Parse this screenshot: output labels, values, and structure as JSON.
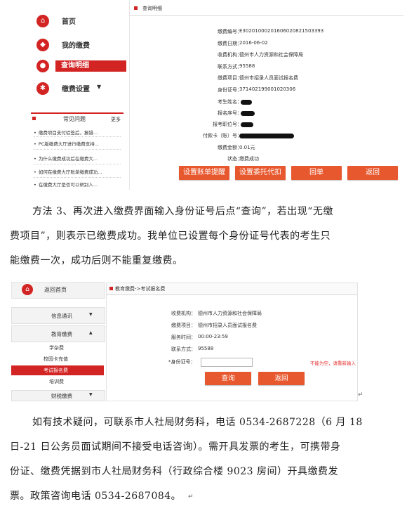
{
  "screenshot1": {
    "nav": [
      {
        "label": "首页",
        "icon": "home-icon",
        "glyph": "⌂"
      },
      {
        "label": "我的缴费",
        "icon": "payment-icon",
        "glyph": "◆"
      },
      {
        "label": "查询明细",
        "icon": "location-icon",
        "glyph": "●"
      },
      {
        "label": "缴费设置",
        "icon": "settings-icon",
        "glyph": "✱",
        "arrow": "▼"
      }
    ],
    "faq": {
      "title": "常见问题",
      "more": "更多",
      "items": [
        "缴费项目支付验签后，报错...",
        "PC版缴费大厅进行缴费支持...",
        "为什么缴费成功后在缴费大...",
        "如何在缴费大厅账单缴费成功...",
        "在缴费大厅是否可以帮别人..."
      ]
    },
    "detail_title": "查询明细",
    "rows": [
      {
        "key": "缴费编号：",
        "value": "E30201000201606020821503393"
      },
      {
        "key": "缴费日期：",
        "value": "2016-06-02"
      },
      {
        "key": "收费机构：",
        "value": "德州市人力资源和社会保障局"
      },
      {
        "key": "联系方式：",
        "value": "95588"
      },
      {
        "key": "缴费项目：",
        "value": "德州市招录人员面试报名费"
      },
      {
        "key": "身份证号：",
        "value": "371402199001020306"
      },
      {
        "key": "考生姓名：",
        "value": ""
      },
      {
        "key": "报名序号：",
        "value": ""
      },
      {
        "key": "报考职位号：",
        "value": ""
      },
      {
        "key": "付款卡（账）号：",
        "value": ""
      },
      {
        "key": "缴费金额：",
        "value": "0.01元"
      },
      {
        "key": "状态：",
        "value": "缴费成功"
      }
    ],
    "buttons": [
      "设置账单提醒",
      "设置委托代扣",
      "回单",
      "返回"
    ]
  },
  "paragraph1": [
    "方法 3、再次进入缴费界面输入身份证号后点“查询”，若出现“无缴",
    "费项目”，则表示已缴费成功。我单位已设置每个身份证号代表的考生只",
    "能缴费一次，成功后则不能重复缴费。"
  ],
  "screenshot2": {
    "home_label": "返回首页",
    "menus": [
      {
        "label": "信息通讯",
        "arrow": "▼"
      },
      {
        "label": "教育缴费",
        "arrow": "▲"
      }
    ],
    "subitems": [
      "学杂费",
      "校园卡充值",
      "考试报名费",
      "培训费"
    ],
    "menu_bottom": {
      "label": "财税缴费",
      "arrow": "▼"
    },
    "breadcrumb": "教育缴费->考试报名费",
    "rows": [
      {
        "key": "收费机构：",
        "value": "德州市人力资源和社会保障局"
      },
      {
        "key": "缴费项目：",
        "value": "德州市招录人员面试报名费"
      },
      {
        "key": "服务时间：",
        "value": "00:00-23:59"
      },
      {
        "key": "联系方式：",
        "value": "95588"
      }
    ],
    "id_label": "*身份证号：",
    "id_value": "",
    "error": "不能为空，请重新输入",
    "buttons": [
      "查询",
      "返回"
    ]
  },
  "paragraph2": [
    "如有技术疑问，可联系市人社局财务科，电话 0534-2687228（6 月 18",
    "日-21 日公务员面试期间不接受电话咨询）。需开具发票的考生，可携带身",
    "份证、缴费凭据到市人社局财务科（行政综合楼 9023 房间）开具缴费发",
    "票。政策咨询电话 0534-2687084。"
  ],
  "colors": {
    "accent": "#d32424",
    "button": "#e8582e",
    "error": "#e53131"
  }
}
